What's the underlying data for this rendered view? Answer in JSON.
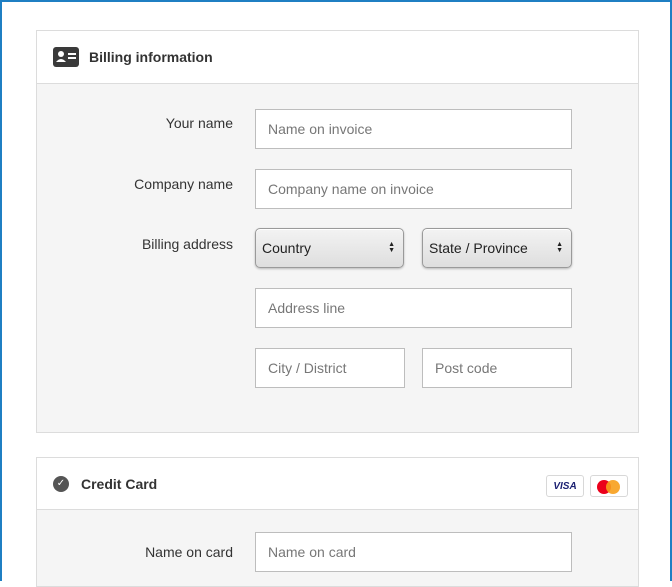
{
  "billing": {
    "title": "Billing information",
    "icon": "id-card-icon",
    "name_label": "Your name",
    "name_placeholder": "Name on invoice",
    "company_label": "Company name",
    "company_placeholder": "Company name on invoice",
    "address_label": "Billing address",
    "country_select": "Country",
    "state_select": "State / Province",
    "address_placeholder": "Address line",
    "city_placeholder": "City / District",
    "postcode_placeholder": "Post code"
  },
  "card": {
    "title": "Credit Card",
    "icon": "check-circle-icon",
    "visa_label": "VISA",
    "mastercard_icon": "mastercard-icon",
    "name_label": "Name on card",
    "name_placeholder": "Name on card"
  },
  "colors": {
    "frame_border": "#1f7fc3",
    "panel_bg": "#f5f5f5",
    "panel_border": "#dcdcdc"
  }
}
